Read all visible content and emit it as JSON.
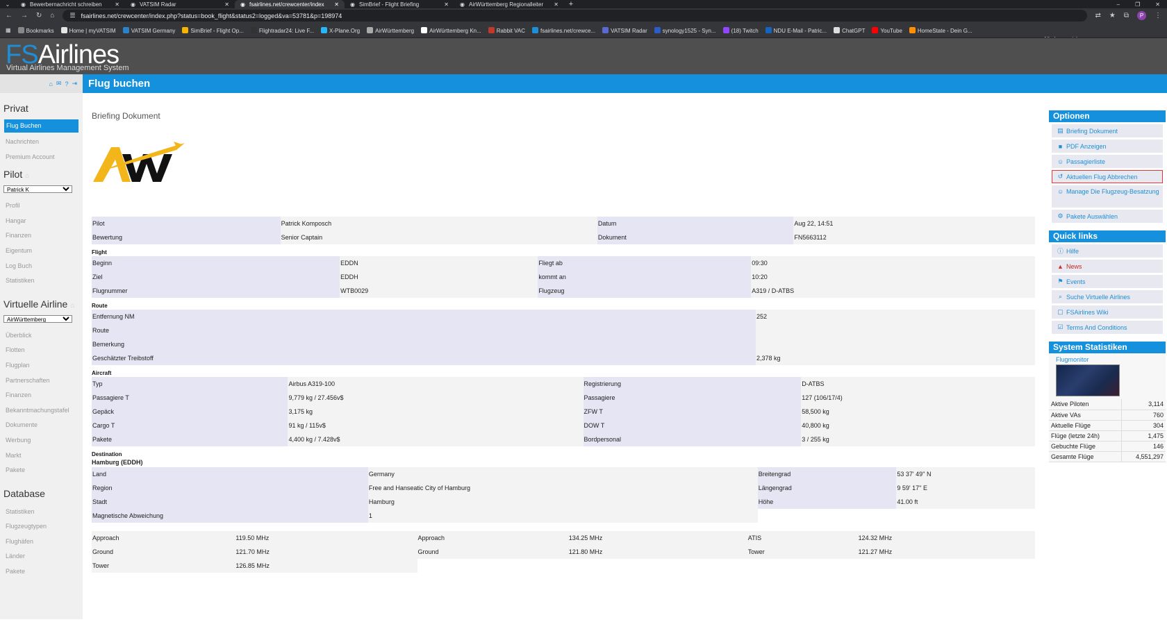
{
  "browser": {
    "tabs": [
      {
        "label": "Bewerbernachricht schreiben"
      },
      {
        "label": "VATSIM Radar"
      },
      {
        "label": "fsairlines.net/crewcenter/index",
        "active": true
      },
      {
        "label": "SimBrief - Flight Briefing"
      },
      {
        "label": "AirWürttemberg Regionalleiter"
      }
    ],
    "url": "fsairlines.net/crewcenter/index.php?status=book_flight&status2=logged&va=53781&p=198974",
    "bookmarks": [
      "Bookmarks",
      "Home | myVATSIM",
      "VATSIM Germany",
      "SimBrief - Flight Op...",
      "Flightradar24: Live F...",
      "X-Plane.Org",
      "AirWürttemberg",
      "AirWürttemberg Kn...",
      "Rabbit VAC",
      "fsairlines.net/crewce...",
      "VATSIM Radar",
      "synology1525 - Syn...",
      "(18) Twitch",
      "NDU E-Mail - Patric...",
      "ChatGPT",
      "YouTube",
      "HomeState - Dein G..."
    ],
    "bookmarks_right": "Alle Lesezeichen"
  },
  "site": {
    "logo_fs": "FS",
    "logo_airlines": "Airlines",
    "logo_sub": "Virtual Airlines Management System",
    "page_title": "Flug buchen"
  },
  "sidebar": {
    "privat_title": "Privat",
    "privat": [
      "Flug Buchen",
      "Nachrichten",
      "Premium Account"
    ],
    "pilot_title": "Pilot",
    "pilot_select": "Patrick K",
    "pilot": [
      "Profil",
      "Hangar",
      "Finanzen",
      "Eigentum",
      "Log Buch",
      "Statistiken"
    ],
    "va_title": "Virtuelle Airline",
    "va_select": "AirWürttemberg",
    "va": [
      "Überblick",
      "Flotten",
      "Flugplan",
      "Partnerschaften",
      "Finanzen",
      "Bekanntmachungstafel",
      "Dokumente",
      "Werbung",
      "Markt",
      "Pakete"
    ],
    "db_title": "Database",
    "db": [
      "Statistiken",
      "Flugzeugtypen",
      "Flughäfen",
      "Länder",
      "Pakete"
    ]
  },
  "doc": {
    "title": "Briefing Dokument",
    "header": {
      "pilot_l": "Pilot",
      "pilot_v": "Patrick Komposch",
      "datum_l": "Datum",
      "datum_v": "Aug 22, 14:51",
      "bew_l": "Bewertung",
      "bew_v": "Senior Captain",
      "dok_l": "Dokument",
      "dok_v": "FN5663112"
    },
    "flight_title": "Flight",
    "flight": [
      [
        "Beginn",
        "EDDN",
        "Fliegt ab",
        "09:30"
      ],
      [
        "Ziel",
        "EDDH",
        "kommt an",
        "10:20"
      ],
      [
        "Flugnummer",
        "WTB0029",
        "Flugzeug",
        "A319 / D-ATBS"
      ]
    ],
    "route_title": "Route",
    "route": [
      [
        "Entfernung NM",
        "252"
      ],
      [
        "Route",
        ""
      ],
      [
        "Bemerkung",
        ""
      ],
      [
        "Geschätzter Treibstoff",
        "2,378 kg"
      ]
    ],
    "aircraft_title": "Aircraft",
    "aircraft": [
      [
        "Typ",
        "Airbus A319-100",
        "Registrierung",
        "D-ATBS"
      ],
      [
        "Passagiere T",
        "9,779 kg / 27.456v$",
        "Passagiere",
        "127 (106/17/4)"
      ],
      [
        "Gepäck",
        "3,175 kg",
        "ZFW T",
        "58,500 kg"
      ],
      [
        "Cargo T",
        "91 kg / 115v$",
        "DOW T",
        "40,800 kg"
      ],
      [
        "Pakete",
        "4,400 kg / 7.428v$",
        "Bordpersonal",
        "3 / 255 kg"
      ]
    ],
    "dest_title": "Destination",
    "dest_name": "Hamburg (EDDH)",
    "dest": [
      [
        "Land",
        "Germany",
        "Breitengrad",
        "53 37' 49'' N"
      ],
      [
        "Region",
        "Free and Hanseatic City of Hamburg",
        "Längengrad",
        "9 59' 17'' E"
      ],
      [
        "Stadt",
        "Hamburg",
        "Höhe",
        "41.00 ft"
      ],
      [
        "Magnetische Abweichung",
        "1",
        "",
        ""
      ]
    ],
    "freq": [
      [
        "Approach",
        "119.50 MHz",
        "Approach",
        "134.25 MHz",
        "ATIS",
        "124.32 MHz"
      ],
      [
        "Ground",
        "121.70 MHz",
        "Ground",
        "121.80 MHz",
        "Tower",
        "121.27 MHz"
      ],
      [
        "Tower",
        "126.85 MHz",
        "",
        "",
        "",
        ""
      ]
    ]
  },
  "options": {
    "title": "Optionen",
    "items": [
      "Briefing Dokument",
      "PDF Anzeigen",
      "Passagierliste",
      "Aktuellen Flug Abbrechen",
      "Manage Die Flugzeug-Besatzung",
      "Pakete Auswählen"
    ]
  },
  "quick": {
    "title": "Quick links",
    "items": [
      "Hilfe",
      "News",
      "Events",
      "Suche Virtuelle Airlines",
      "FSAirlines Wiki",
      "Terms And Conditions"
    ]
  },
  "stats": {
    "title": "System Statistiken",
    "monitor": "Flugmonitor",
    "rows": [
      [
        "Aktive Piloten",
        "3,114"
      ],
      [
        "Aktive VAs",
        "760"
      ],
      [
        "Aktuelle Flüge",
        "304"
      ],
      [
        "Flüge (letzte 24h)",
        "1,475"
      ],
      [
        "Gebuchte Flüge",
        "146"
      ],
      [
        "Gesamte Flüge",
        "4,551,297"
      ]
    ]
  },
  "colors": {
    "accent": "#1590dd",
    "highlight": "#e53935"
  }
}
